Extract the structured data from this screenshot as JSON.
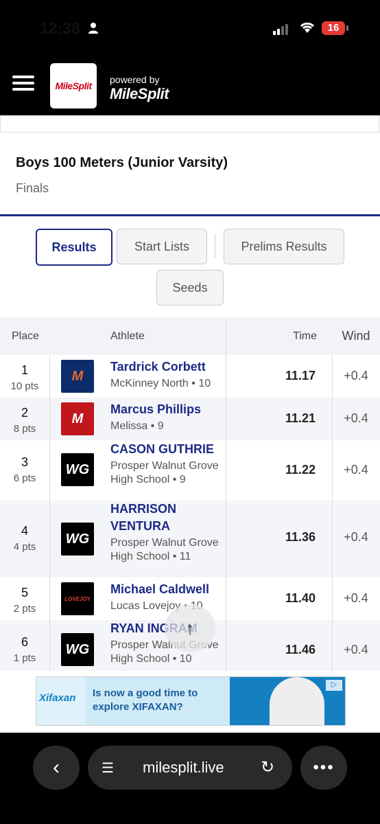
{
  "status_bar": {
    "time": "12:38",
    "battery": "16"
  },
  "header": {
    "logo": "MileSplit",
    "powered_by": "powered by",
    "powered_logo": "MileSplit"
  },
  "event": {
    "title": "Boys 100 Meters (Junior Varsity)",
    "round": "Finals"
  },
  "tabs": {
    "results": "Results",
    "start_lists": "Start Lists",
    "prelims": "Prelims Results",
    "seeds": "Seeds"
  },
  "table": {
    "headers": {
      "place": "Place",
      "athlete": "Athlete",
      "time": "Time",
      "wind": "Wind"
    },
    "rows": [
      {
        "place": "1",
        "pts": "10 pts",
        "name": "Tardrick Corbett",
        "team": "McKinney North • 10",
        "time": "11.17",
        "wind": "+0.4",
        "logo": "M"
      },
      {
        "place": "2",
        "pts": "8 pts",
        "name": "Marcus Phillips",
        "team": "Melissa • 9",
        "time": "11.21",
        "wind": "+0.4",
        "logo": "M"
      },
      {
        "place": "3",
        "pts": "6 pts",
        "name": "CASON GUTHRIE",
        "team": "Prosper Walnut Grove High School • 9",
        "time": "11.22",
        "wind": "+0.4",
        "logo": "WG"
      },
      {
        "place": "4",
        "pts": "4 pts",
        "name": "HARRISON VENTURA",
        "team": "Prosper Walnut Grove High School • 11",
        "time": "11.36",
        "wind": "+0.4",
        "logo": "WG"
      },
      {
        "place": "5",
        "pts": "2 pts",
        "name": "Michael Caldwell",
        "team": "Lucas Lovejoy • 10",
        "time": "11.40",
        "wind": "+0.4",
        "logo": "LOVEJOY"
      },
      {
        "place": "6",
        "pts": "1 pts",
        "name": "RYAN INGRAM",
        "team": "Prosper Walnut Grove High School • 10",
        "time": "11.46",
        "wind": "+0.4",
        "logo": "WG"
      }
    ]
  },
  "ad": {
    "brand": "Xifaxan",
    "copy": "Is now a good time to explore XIFAXAN?"
  },
  "browser": {
    "url": "milesplit.live"
  },
  "colors": {
    "accent": "#1c2a87",
    "header_bg": "#000000",
    "battery": "#e53935"
  }
}
